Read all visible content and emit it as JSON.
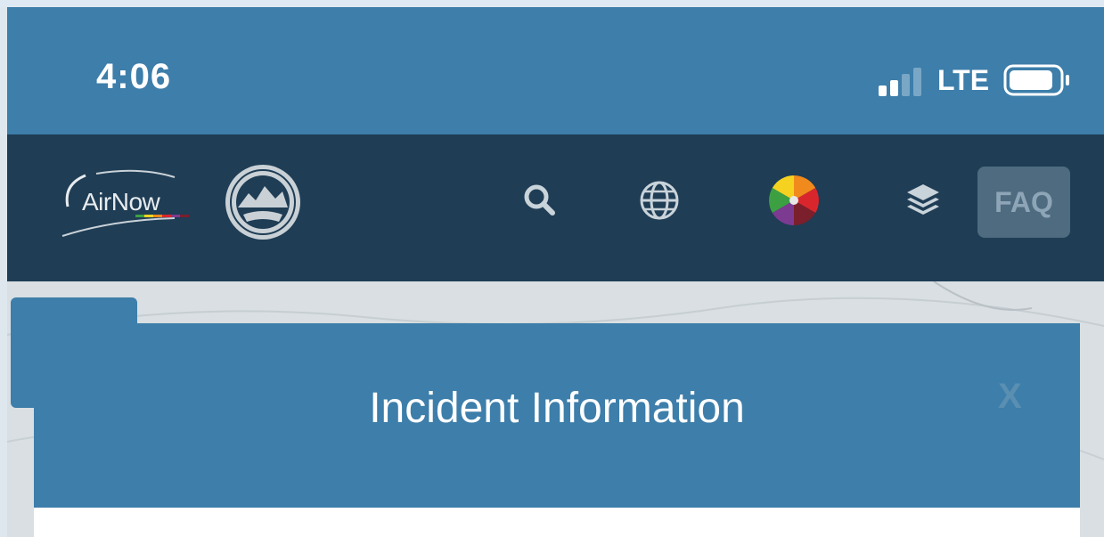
{
  "status_bar": {
    "time": "4:06",
    "network": "LTE",
    "signal_icon": "signal-bars-icon",
    "battery_icon": "battery-icon"
  },
  "navbar": {
    "logo_text": "AirNow",
    "seal_icon": "interagency-wildland-fire-seal",
    "icons": [
      "search-icon",
      "globe-icon",
      "color-wheel-icon",
      "layers-icon"
    ],
    "faq_label": "FAQ",
    "colors": {
      "bg": "#1f3d55",
      "faq_bg": "#4e6b80"
    }
  },
  "modal": {
    "title": "Incident Information",
    "close_label": "X",
    "colors": {
      "header": "#3d7eaa",
      "body": "#ffffff"
    }
  }
}
